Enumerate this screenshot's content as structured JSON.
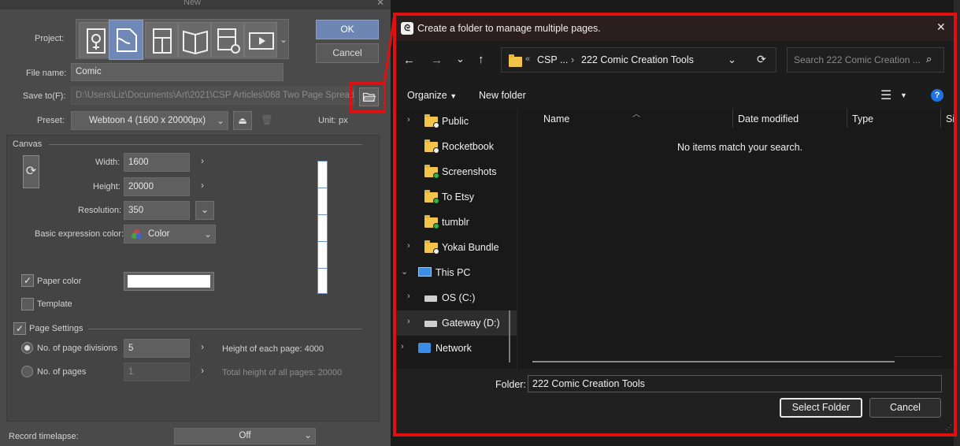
{
  "csp": {
    "title": "New",
    "project_label": "Project:",
    "ok": "OK",
    "cancel": "Cancel",
    "file_name_label": "File name:",
    "file_name": "Comic",
    "save_to_label": "Save to(F):",
    "save_to_path": "D:\\Users\\Liz\\Documents\\Art\\2021\\CSP Articles\\068 Two Page Spreads ...",
    "preset_label": "Preset:",
    "preset_value": "Webtoon 4 (1600 x 20000px)",
    "unit_label": "Unit:",
    "unit_value": "px",
    "canvas_section": "Canvas",
    "width_label": "Width:",
    "width_value": "1600",
    "height_label": "Height:",
    "height_value": "20000",
    "resolution_label": "Resolution:",
    "resolution_value": "350",
    "expression_label": "Basic expression color:",
    "expression_value": "Color",
    "paper_color_label": "Paper color",
    "paper_color": "#ffffff",
    "template_label": "Template",
    "page_settings_label": "Page Settings",
    "page_divisions_label": "No. of page divisions",
    "page_divisions_value": "5",
    "height_each_page": "Height of each page: 4000",
    "num_pages_label": "No. of pages",
    "num_pages_value": "1",
    "total_height": "Total height of all pages: 20000",
    "timelapse_label": "Record timelapse:",
    "timelapse_value": "Off"
  },
  "dialog": {
    "title": "Create a folder to manage multiple pages.",
    "breadcrumb_root": "CSP ...",
    "breadcrumb_current": "222 Comic Creation Tools",
    "search_placeholder": "Search 222 Comic Creation ...",
    "organize": "Organize",
    "new_folder": "New folder",
    "columns": [
      "Name",
      "Date modified",
      "Type",
      "Si"
    ],
    "empty_message": "No items match your search.",
    "tree": [
      {
        "label": "Public",
        "badge": "#f0f0f0"
      },
      {
        "label": "Rocketbook",
        "badge": "#f0f0f0"
      },
      {
        "label": "Screenshots",
        "badge": "#2fb344"
      },
      {
        "label": "To Etsy",
        "badge": "#2fb344"
      },
      {
        "label": "tumblr",
        "badge": "#2fb344"
      },
      {
        "label": "Yokai Bundle",
        "badge": "#f0f0f0"
      },
      {
        "label": "This PC",
        "badge": ""
      },
      {
        "label": "OS (C:)",
        "badge": ""
      },
      {
        "label": "Gateway (D:)",
        "badge": ""
      },
      {
        "label": "Network",
        "badge": ""
      }
    ],
    "folder_label": "Folder:",
    "folder_value": "222 Comic Creation Tools",
    "select_folder": "Select Folder",
    "cancel": "Cancel"
  },
  "colors": {
    "highlight": "#e01010",
    "accent": "#6f88b6"
  }
}
